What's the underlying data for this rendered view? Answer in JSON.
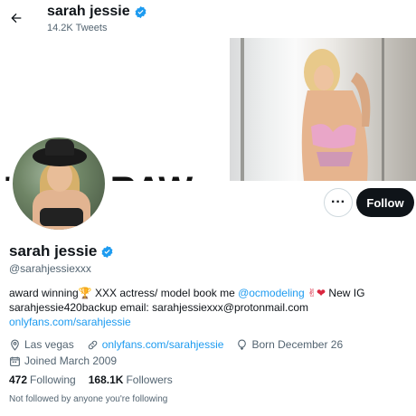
{
  "header": {
    "name": "sarah jessie",
    "tweets": "14.2K Tweets"
  },
  "banner": {
    "text": "TONY RAW"
  },
  "actions": {
    "more_label": "···",
    "follow_label": "Follow"
  },
  "profile": {
    "name": "sarah jessie",
    "handle": "@sarahjessiexxx",
    "bio": {
      "line1_a": "award winning",
      "line1_trophy": "🏆",
      "line1_b": " XXX actress/ model book me ",
      "line1_mention": "@ocmodeling",
      "line1_emoji": " ✌❤",
      "line1_c": " New IG",
      "line2": "sarahjessie420backup email: sarahjessiexxx@protonmail.com",
      "line3": "onlyfans.com/sarahjessie"
    },
    "location": "Las vegas",
    "website": "onlyfans.com/sarahjessie",
    "birthday": "Born December 26",
    "joined": "Joined March 2009",
    "following_count": "472",
    "following_label": "Following",
    "followers_count": "168.1K",
    "followers_label": "Followers",
    "followed_note": "Not followed by anyone you're following"
  },
  "colors": {
    "accent": "#1d9bf0",
    "text": "#0f1419",
    "muted": "#536471",
    "follow_bg": "#0f1419"
  },
  "icons": {
    "back": "arrow-left-icon",
    "verified": "verified-badge-icon",
    "location": "location-pin-icon",
    "link": "link-icon",
    "birthday": "balloon-icon",
    "calendar": "calendar-icon"
  }
}
